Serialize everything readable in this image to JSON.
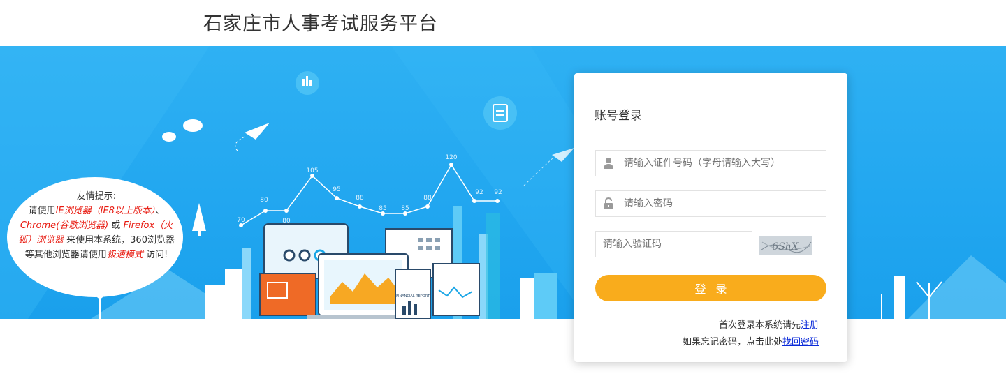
{
  "header": {
    "title": "石家庄市人事考试服务平台"
  },
  "tip": {
    "heading": "友情提示:",
    "line1_a": "请使用",
    "line1_b": "IE浏览器（IE8以上版本）",
    "line1_c": "、",
    "line2_a": "Chrome(谷歌浏览器)",
    "line2_b": " 或 ",
    "line2_c": "Firefox（火",
    "line3_a": "狐）浏览器",
    "line3_b": " 来使用本系统，360浏览器",
    "line4_a": "等其他浏览器请使用",
    "line4_b": "极速模式",
    "line4_c": " 访问!"
  },
  "chart_labels": [
    "70",
    "80",
    "80",
    "105",
    "95",
    "88",
    "85",
    "85",
    "88",
    "120",
    "92",
    "92"
  ],
  "report_label": "FINANCIAL REPORT",
  "login": {
    "title": "账号登录",
    "id_placeholder": "请输入证件号码（字母请输入大写）",
    "pwd_placeholder": "请输入密码",
    "code_placeholder": "请输入验证码",
    "captcha_text": "6ShX",
    "button_label": "登录",
    "hint1_text": "首次登录本系统请先",
    "hint1_link": "注册",
    "hint2_text": "如果忘记密码，点击此处",
    "hint2_link": "找回密码"
  },
  "colors": {
    "banner": "#22a7f0",
    "button": "#f9ac1c",
    "link": "#0a2ad9",
    "tip_red": "#e8190f"
  }
}
